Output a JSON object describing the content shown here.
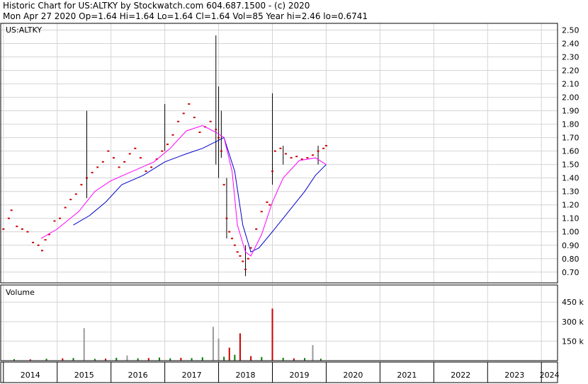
{
  "header": {
    "line1": "Historic Chart for US:ALTKY by Stockwatch.com 604.687.1500 - (c) 2020",
    "line2": "Mon Apr 27 2020  Op=1.64  Hi=1.64  Lo=1.64  Cl=1.64  Vol=85  Year hi=2.46  lo=0.6741"
  },
  "chart_data": [
    {
      "type": "line",
      "title": "US:ALTKY",
      "y_tick_labels": [
        "2.50",
        "2.40",
        "2.30",
        "2.20",
        "2.10",
        "2.00",
        "1.90",
        "1.80",
        "1.70",
        "1.60",
        "1.50",
        "1.40",
        "1.30",
        "1.20",
        "1.10",
        "1.00",
        "0.90",
        "0.80",
        "0.70"
      ],
      "ylim": [
        0.62,
        2.55
      ],
      "x_tick_labels": [
        "2014",
        "2015",
        "2016",
        "2017",
        "2018",
        "2019",
        "2020",
        "2021",
        "2022",
        "2023",
        "2024"
      ],
      "xlim": [
        2013.95,
        2024.3
      ],
      "grid": true,
      "colors": {
        "price": "#cc0000",
        "range": "#000000",
        "fast_ma": "#ff00ff",
        "slow_ma": "#0000cc"
      },
      "price_points": [
        [
          2014.0,
          1.02
        ],
        [
          2014.1,
          1.1
        ],
        [
          2014.15,
          1.16
        ],
        [
          2014.25,
          1.04
        ],
        [
          2014.35,
          1.02
        ],
        [
          2014.45,
          1.0
        ],
        [
          2014.55,
          0.92
        ],
        [
          2014.65,
          0.9
        ],
        [
          2014.72,
          0.86
        ],
        [
          2014.78,
          0.94
        ],
        [
          2014.85,
          0.98
        ],
        [
          2014.95,
          1.08
        ],
        [
          2015.05,
          1.1
        ],
        [
          2015.15,
          1.18
        ],
        [
          2015.25,
          1.24
        ],
        [
          2015.35,
          1.28
        ],
        [
          2015.45,
          1.35
        ],
        [
          2015.55,
          1.4
        ],
        [
          2015.65,
          1.44
        ],
        [
          2015.75,
          1.48
        ],
        [
          2015.85,
          1.52
        ],
        [
          2015.95,
          1.6
        ],
        [
          2016.05,
          1.55
        ],
        [
          2016.15,
          1.48
        ],
        [
          2016.25,
          1.52
        ],
        [
          2016.35,
          1.58
        ],
        [
          2016.45,
          1.62
        ],
        [
          2016.55,
          1.55
        ],
        [
          2016.65,
          1.45
        ],
        [
          2016.75,
          1.48
        ],
        [
          2016.85,
          1.54
        ],
        [
          2016.95,
          1.6
        ],
        [
          2017.05,
          1.65
        ],
        [
          2017.15,
          1.72
        ],
        [
          2017.25,
          1.82
        ],
        [
          2017.35,
          1.88
        ],
        [
          2017.45,
          1.95
        ],
        [
          2017.55,
          1.85
        ],
        [
          2017.65,
          1.74
        ],
        [
          2017.75,
          1.78
        ],
        [
          2017.85,
          1.82
        ],
        [
          2017.95,
          1.76
        ],
        [
          2018.0,
          1.7
        ],
        [
          2018.05,
          1.6
        ],
        [
          2018.1,
          1.35
        ],
        [
          2018.15,
          1.1
        ],
        [
          2018.2,
          1.0
        ],
        [
          2018.25,
          0.95
        ],
        [
          2018.3,
          0.9
        ],
        [
          2018.35,
          0.85
        ],
        [
          2018.4,
          0.82
        ],
        [
          2018.45,
          0.78
        ],
        [
          2018.5,
          0.72
        ],
        [
          2018.55,
          0.8
        ],
        [
          2018.6,
          0.88
        ],
        [
          2018.7,
          1.02
        ],
        [
          2018.8,
          1.15
        ],
        [
          2018.9,
          1.22
        ],
        [
          2018.95,
          1.2
        ],
        [
          2019.0,
          1.45
        ],
        [
          2019.05,
          1.6
        ],
        [
          2019.15,
          1.62
        ],
        [
          2019.25,
          1.58
        ],
        [
          2019.35,
          1.55
        ],
        [
          2019.45,
          1.56
        ],
        [
          2019.55,
          1.54
        ],
        [
          2019.65,
          1.55
        ],
        [
          2019.75,
          1.57
        ],
        [
          2019.85,
          1.6
        ],
        [
          2019.95,
          1.62
        ],
        [
          2020.0,
          1.64
        ]
      ],
      "range_bars": [
        [
          2015.55,
          1.9,
          1.25
        ],
        [
          2017.0,
          1.95,
          1.6
        ],
        [
          2017.95,
          2.46,
          1.5
        ],
        [
          2018.0,
          2.08,
          1.4
        ],
        [
          2018.05,
          1.9,
          1.55
        ],
        [
          2018.15,
          1.4,
          0.95
        ],
        [
          2018.5,
          0.9,
          0.67
        ],
        [
          2019.0,
          2.03,
          1.35
        ],
        [
          2019.2,
          1.64,
          1.5
        ],
        [
          2019.85,
          1.64,
          1.5
        ]
      ],
      "fast_ma": [
        [
          2014.7,
          0.95
        ],
        [
          2015.0,
          1.02
        ],
        [
          2015.4,
          1.15
        ],
        [
          2015.7,
          1.3
        ],
        [
          2016.0,
          1.38
        ],
        [
          2016.4,
          1.45
        ],
        [
          2016.8,
          1.52
        ],
        [
          2017.1,
          1.62
        ],
        [
          2017.4,
          1.75
        ],
        [
          2017.7,
          1.79
        ],
        [
          2017.95,
          1.74
        ],
        [
          2018.1,
          1.7
        ],
        [
          2018.25,
          1.45
        ],
        [
          2018.35,
          1.05
        ],
        [
          2018.5,
          0.85
        ],
        [
          2018.6,
          0.82
        ],
        [
          2018.8,
          0.98
        ],
        [
          2019.0,
          1.22
        ],
        [
          2019.2,
          1.4
        ],
        [
          2019.5,
          1.53
        ],
        [
          2019.8,
          1.55
        ],
        [
          2020.0,
          1.5
        ]
      ],
      "slow_ma": [
        [
          2015.3,
          1.05
        ],
        [
          2015.6,
          1.12
        ],
        [
          2015.9,
          1.22
        ],
        [
          2016.2,
          1.35
        ],
        [
          2016.6,
          1.42
        ],
        [
          2017.0,
          1.52
        ],
        [
          2017.4,
          1.58
        ],
        [
          2017.7,
          1.62
        ],
        [
          2017.95,
          1.67
        ],
        [
          2018.1,
          1.7
        ],
        [
          2018.3,
          1.45
        ],
        [
          2018.45,
          1.05
        ],
        [
          2018.6,
          0.85
        ],
        [
          2018.75,
          0.88
        ],
        [
          2019.0,
          1.0
        ],
        [
          2019.3,
          1.15
        ],
        [
          2019.6,
          1.3
        ],
        [
          2019.8,
          1.42
        ],
        [
          2020.0,
          1.5
        ]
      ]
    },
    {
      "type": "bar",
      "title": "Volume",
      "y_tick_labels": [
        "450 k",
        "300 k",
        "150 k"
      ],
      "ylim": [
        0,
        560
      ],
      "x_tick_labels": [
        "2014",
        "2015",
        "2016",
        "2017",
        "2018",
        "2019",
        "2020",
        "2021",
        "2022",
        "2023",
        "2024"
      ],
      "colors": {
        "up": "#008000",
        "down": "#cc0000",
        "other": "#999999"
      },
      "volumes": [
        [
          2015.5,
          250,
          "other"
        ],
        [
          2016.3,
          40,
          "other"
        ],
        [
          2017.9,
          260,
          "other"
        ],
        [
          2018.0,
          170,
          "other"
        ],
        [
          2018.2,
          100,
          "down"
        ],
        [
          2018.4,
          210,
          "down"
        ],
        [
          2019.0,
          400,
          "down"
        ],
        [
          2019.75,
          120,
          "other"
        ],
        [
          2014.2,
          12,
          "up"
        ],
        [
          2014.5,
          10,
          "down"
        ],
        [
          2014.8,
          15,
          "up"
        ],
        [
          2015.1,
          18,
          "down"
        ],
        [
          2015.3,
          20,
          "up"
        ],
        [
          2015.7,
          14,
          "up"
        ],
        [
          2015.9,
          16,
          "down"
        ],
        [
          2016.1,
          22,
          "up"
        ],
        [
          2016.5,
          18,
          "up"
        ],
        [
          2016.7,
          20,
          "down"
        ],
        [
          2016.9,
          24,
          "up"
        ],
        [
          2017.1,
          18,
          "up"
        ],
        [
          2017.3,
          22,
          "down"
        ],
        [
          2017.5,
          20,
          "up"
        ],
        [
          2017.7,
          26,
          "up"
        ],
        [
          2018.1,
          30,
          "up"
        ],
        [
          2018.3,
          45,
          "up"
        ],
        [
          2018.6,
          35,
          "down"
        ],
        [
          2018.8,
          28,
          "up"
        ],
        [
          2019.2,
          22,
          "up"
        ],
        [
          2019.4,
          18,
          "down"
        ],
        [
          2019.6,
          20,
          "up"
        ],
        [
          2019.9,
          15,
          "up"
        ]
      ]
    }
  ]
}
